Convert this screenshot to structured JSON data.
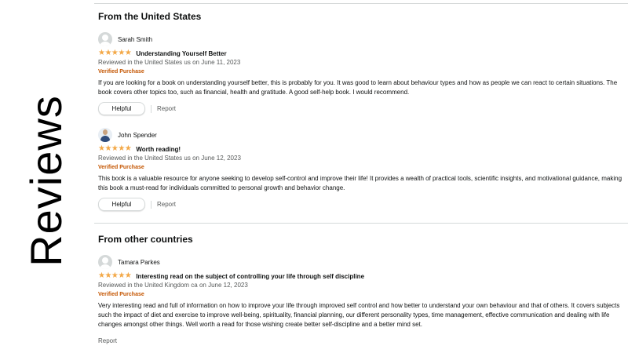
{
  "side_title": "Reviews",
  "sections": [
    {
      "title": "From the United States"
    },
    {
      "title": "From other countries"
    }
  ],
  "reviews": [
    {
      "name": "Sarah Smith",
      "avatar": "default-avatar",
      "rating": 5,
      "stars": "★★★★★",
      "title": "Understanding Yourself Better",
      "meta": "Reviewed in the United States us on June 11, 2023",
      "verified": "Verified Purchase",
      "body": "If you are looking for a book on understanding yourself better, this is probably for you. It was good to learn about behaviour types and how as people we can react to certain situations. The book covers other topics too, such as financial, health and gratitude. A good self-help book. I would recommend.",
      "helpful_label": "Helpful",
      "report_label": "Report"
    },
    {
      "name": "John Spender",
      "avatar": "photo-avatar",
      "rating": 5,
      "stars": "★★★★★",
      "title": "Worth reading!",
      "meta": "Reviewed in the United States us on June 12, 2023",
      "verified": "Verified Purchase",
      "body": "This book is a valuable resource for anyone seeking to develop self-control and improve their life! It provides a wealth of practical tools, scientific insights, and motivational guidance, making this book a must-read for individuals committed to personal growth and behavior change.",
      "helpful_label": "Helpful",
      "report_label": "Report"
    },
    {
      "name": "Tamara Parkes",
      "avatar": "default-avatar",
      "rating": 5,
      "stars": "★★★★★",
      "title": "Interesting read on the subject of controlling your life through self discipline",
      "meta": "Reviewed in the United Kingdom ca on June 12, 2023",
      "verified": "Verified Purchase",
      "body": "Very interesting read and full of information on how to improve your life through improved self control and how better to understand your own behaviour and that of others. It covers subjects such the impact of diet and exercise to improve well-being, spirituality, financial planning, our different personality types, time management, effective communication and dealing with life changes amongst other things. Well worth a read for those wishing create better self-discipline and a better mind set.",
      "report_label": "Report"
    }
  ],
  "colors": {
    "star": "#f3a847",
    "verified": "#c45500",
    "meta": "#565959",
    "rule": "#d5d9d9"
  }
}
